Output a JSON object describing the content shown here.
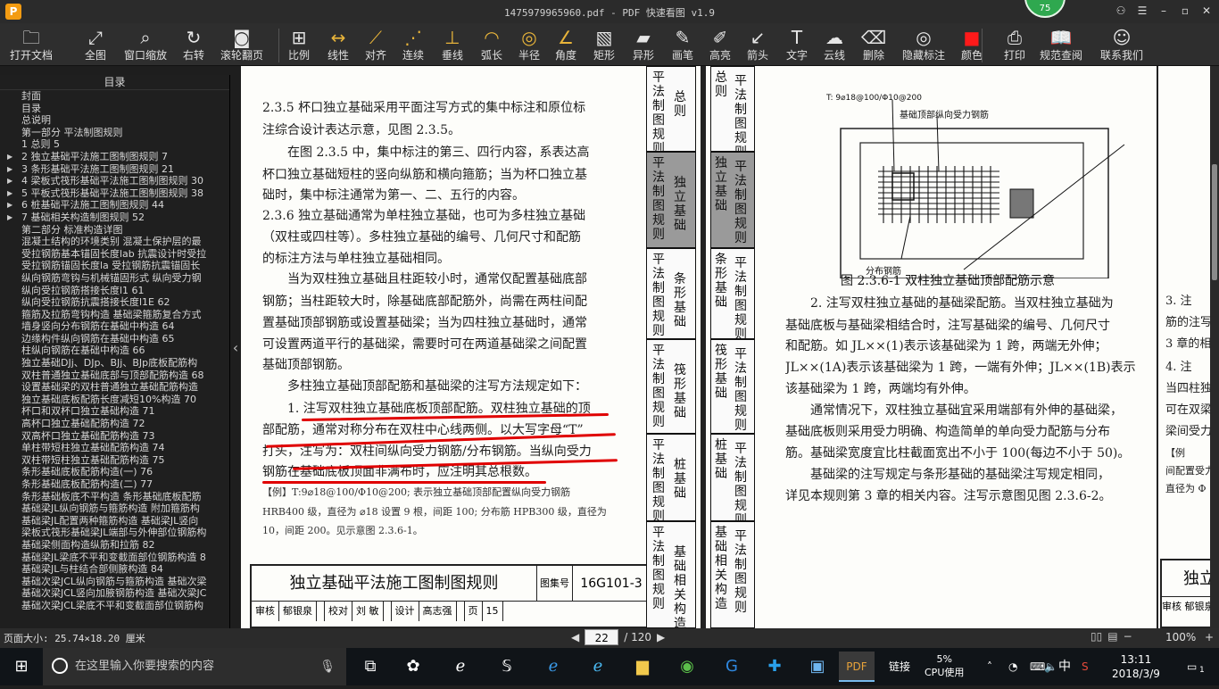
{
  "window": {
    "title": "1475979965960.pdf - PDF 快速看图 v1.9",
    "logo": "P",
    "badge": "75"
  },
  "toolbar": [
    {
      "label": "打开文档",
      "icon": "folder-icon",
      "glyph": "🗀"
    },
    {
      "label": "全图",
      "icon": "fit-icon",
      "glyph": "⤢"
    },
    {
      "label": "窗口缩放",
      "icon": "zoom-icon",
      "glyph": "⌕"
    },
    {
      "label": "右转",
      "icon": "rotate-icon",
      "glyph": "↻"
    },
    {
      "label": "滚轮翻页",
      "icon": "mouse-icon",
      "glyph": "◙"
    },
    {
      "label": "比例",
      "icon": "scale-icon",
      "glyph": "⊞"
    },
    {
      "label": "线性",
      "icon": "linear-icon",
      "glyph": "↔"
    },
    {
      "label": "对齐",
      "icon": "align-icon",
      "glyph": "⟋"
    },
    {
      "label": "连续",
      "icon": "continuous-icon",
      "glyph": "⋰"
    },
    {
      "label": "垂线",
      "icon": "perpendicular-icon",
      "glyph": "⊥"
    },
    {
      "label": "弧长",
      "icon": "arc-icon",
      "glyph": "◠"
    },
    {
      "label": "半径",
      "icon": "radius-icon",
      "glyph": "◎"
    },
    {
      "label": "角度",
      "icon": "angle-icon",
      "glyph": "∠"
    },
    {
      "label": "矩形",
      "icon": "rect-icon",
      "glyph": "▧"
    },
    {
      "label": "异形",
      "icon": "polygon-icon",
      "glyph": "▰"
    },
    {
      "label": "画笔",
      "icon": "pen-icon",
      "glyph": "✎"
    },
    {
      "label": "高亮",
      "icon": "highlight-icon",
      "glyph": "✐"
    },
    {
      "label": "箭头",
      "icon": "arrow-icon",
      "glyph": "↙"
    },
    {
      "label": "文字",
      "icon": "text-icon",
      "glyph": "T"
    },
    {
      "label": "云线",
      "icon": "cloud-icon",
      "glyph": "☁"
    },
    {
      "label": "删除",
      "icon": "eraser-icon",
      "glyph": "⌫"
    },
    {
      "label": "隐藏标注",
      "icon": "hide-icon",
      "glyph": "◎"
    },
    {
      "label": "颜色",
      "icon": "color-icon",
      "glyph": "■"
    },
    {
      "label": "打印",
      "icon": "print-icon",
      "glyph": "⎙"
    },
    {
      "label": "规范查阅",
      "icon": "book-icon",
      "glyph": "📖"
    },
    {
      "label": "联系我们",
      "icon": "contact-icon",
      "glyph": "☺"
    }
  ],
  "sidebar": {
    "title": "目录",
    "items": [
      {
        "label": "封面",
        "arrow": ""
      },
      {
        "label": "目录",
        "arrow": ""
      },
      {
        "label": "总说明",
        "arrow": ""
      },
      {
        "label": "第一部分 平法制图规则",
        "arrow": ""
      },
      {
        "label": "1 总则 5",
        "arrow": ""
      },
      {
        "label": "2 独立基础平法施工图制图规则 7",
        "arrow": "▶"
      },
      {
        "label": "3 条形基础平法施工图制图规则 21",
        "arrow": "▶"
      },
      {
        "label": "4 梁板式筏形基础平法施工图制图规则 30",
        "arrow": "▶"
      },
      {
        "label": "5 平板式筏形基础平法施工图制图规则 38",
        "arrow": "▶"
      },
      {
        "label": "6 桩基础平法施工图制图规则 44",
        "arrow": "▶"
      },
      {
        "label": "7 基础相关构造制图规则 52",
        "arrow": "▶"
      },
      {
        "label": "第二部分 标准构造详图",
        "arrow": ""
      },
      {
        "label": "混凝土结构的环境类别 混凝土保护层的最",
        "arrow": ""
      },
      {
        "label": "受拉钢筋基本锚固长度lab 抗震设计时受拉",
        "arrow": ""
      },
      {
        "label": "受拉钢筋锚固长度la 受拉钢筋抗震锚固长",
        "arrow": ""
      },
      {
        "label": "纵向钢筋弯钩与机械锚固形式 纵向受力钢",
        "arrow": ""
      },
      {
        "label": "纵向受拉钢筋搭接长度l1 61",
        "arrow": ""
      },
      {
        "label": "纵向受拉钢筋抗震搭接长度l1E 62",
        "arrow": ""
      },
      {
        "label": "箍筋及拉筋弯钩构造 基础梁箍筋复合方式",
        "arrow": ""
      },
      {
        "label": "墙身竖向分布钢筋在基础中构造 64",
        "arrow": ""
      },
      {
        "label": "边缘构件纵向钢筋在基础中构造 65",
        "arrow": ""
      },
      {
        "label": "柱纵向钢筋在基础中构造 66",
        "arrow": ""
      },
      {
        "label": "独立基础DJj、DJp、BJj、BJp底板配筋构",
        "arrow": ""
      },
      {
        "label": "双柱普通独立基础底部与顶部配筋构造 68",
        "arrow": ""
      },
      {
        "label": "设置基础梁的双柱普通独立基础配筋构造",
        "arrow": ""
      },
      {
        "label": "独立基础底板配筋长度减短10%构造 70",
        "arrow": ""
      },
      {
        "label": "杯口和双杯口独立基础构造 71",
        "arrow": ""
      },
      {
        "label": "高杯口独立基础配筋构造 72",
        "arrow": ""
      },
      {
        "label": "双高杯口独立基础配筋构造 73",
        "arrow": ""
      },
      {
        "label": "单柱带短柱独立基础配筋构造 74",
        "arrow": ""
      },
      {
        "label": "双柱带短柱独立基础配筋构造 75",
        "arrow": ""
      },
      {
        "label": "条形基础底板配筋构造(一) 76",
        "arrow": ""
      },
      {
        "label": "条形基础底板配筋构造(二) 77",
        "arrow": ""
      },
      {
        "label": "条形基础板底不平构造 条形基础底板配筋",
        "arrow": ""
      },
      {
        "label": "基础梁JL纵向钢筋与箍筋构造 附加箍筋构",
        "arrow": ""
      },
      {
        "label": "基础梁JL配置两种箍筋构造 基础梁JL竖向",
        "arrow": ""
      },
      {
        "label": "梁板式筏形基础梁JL端部与外伸部位钢筋构",
        "arrow": ""
      },
      {
        "label": "基础梁侧面构造纵筋和拉筋 82",
        "arrow": ""
      },
      {
        "label": "基础梁JL梁底不平和变截面部位钢筋构造 8",
        "arrow": ""
      },
      {
        "label": "基础梁JL与柱结合部侧腋构造 84",
        "arrow": ""
      },
      {
        "label": "基础次梁JCL纵向钢筋与箍筋构造 基础次梁",
        "arrow": ""
      },
      {
        "label": "基础次梁JCL竖向加腋钢筋构造 基础次梁JC",
        "arrow": ""
      },
      {
        "label": "基础次梁JCL梁底不平和变截面部位钢筋构",
        "arrow": ""
      }
    ]
  },
  "left_page": {
    "lines": [
      "2.3.5 杯口独立基础采用平面注写方式的集中标注和原位标",
      "注综合设计表达示意，见图 2.3.5。",
      "　　在图 2.3.5 中，集中标注的第三、四行内容，系表达高",
      "杯口独立基础短柱的竖向纵筋和横向箍筋；当为杯口独立基",
      "础时，集中标注通常为第一、二、五行的内容。",
      "2.3.6 独立基础通常为单柱独立基础，也可为多柱独立基础",
      "（双柱或四柱等）。多柱独立基础的编号、几何尺寸和配筋",
      "的标注方法与单柱独立基础相同。",
      "　　当为双柱独立基础且柱距较小时，通常仅配置基础底部",
      "钢筋；当柱距较大时，除基础底部配筋外，尚需在两柱间配",
      "置基础顶部钢筋或设置基础梁；当为四柱独立基础时，通常",
      "可设置两道平行的基础梁，需要时可在两道基础梁之间配置",
      "基础顶部钢筋。",
      "　　多柱独立基础顶部配筋和基础梁的注写方法规定如下：",
      "　　1. 注写双柱独立基础底板顶部配筋。双柱独立基础的顶",
      "部配筋，通常对称分布在双柱中心线两侧。以大写字母“T”",
      "打头，注写为：双柱间纵向受力钢筋/分布钢筋。当纵向受力",
      "钢筋在基础底板顶面非满布时，应注明其总根数。"
    ],
    "example": [
      "【例】T:9⌀18@100/Φ10@200; 表示独立基础顶部配置纵向受力钢筋",
      "HRB400 级，直径为 ⌀18 设置 9 根，间距 100; 分布筋 HPB300 级，直径为",
      "10，间距 200。见示意图 2.3.6-1。"
    ],
    "footer": {
      "title": "独立基础平法施工图制图规则",
      "atlas_label": "图集号",
      "atlas_no": "16G101-3",
      "row2": [
        "审核",
        "郁银泉",
        "",
        "校对",
        "刘 敏",
        "",
        "设计",
        "高志强",
        "",
        "页",
        "15"
      ]
    }
  },
  "side_tabs": [
    {
      "main": "平法制图规则",
      "sub": "总则",
      "active": false
    },
    {
      "main": "平法制图规则",
      "sub": "独立基础",
      "active": true
    },
    {
      "main": "平法制图规则",
      "sub": "条形基础",
      "active": false
    },
    {
      "main": "平法制图规则",
      "sub": "筏形基础",
      "active": false
    },
    {
      "main": "平法制图规则",
      "sub": "桩基础",
      "active": false
    },
    {
      "main": "平法制图规则",
      "sub": "基础相关构造",
      "active": false
    }
  ],
  "right_tabs": [
    {
      "sub": "总则",
      "main": "平法制图规则",
      "active": false
    },
    {
      "sub": "独立基础",
      "main": "平法制图规则",
      "active": true
    },
    {
      "sub": "条形基础",
      "main": "平法制图规则",
      "active": false
    },
    {
      "sub": "筏形基础",
      "main": "平法制图规则",
      "active": false
    },
    {
      "sub": "桩基础",
      "main": "平法制图规则",
      "active": false
    },
    {
      "sub": "基础相关构造",
      "main": "平法制图规则",
      "active": false
    }
  ],
  "figure": {
    "label_top": "T: 9⌀18@100/Φ10@200",
    "label_rebar": "基础顶部纵向受力钢筋",
    "label_dist": "分布钢筋",
    "caption": "图 2.3.6-1 双柱独立基础顶部配筋示意"
  },
  "right_page": {
    "lines": [
      "　　2. 注写双柱独立基础的基础梁配筋。当双柱独立基础为",
      "基础底板与基础梁相结合时，注写基础梁的编号、几何尺寸",
      "和配筋。如 JL××(1)表示该基础梁为 1 跨，两端无外伸；",
      "JL××(1A)表示该基础梁为 1 跨，一端有外伸；JL××(1B)表示",
      "该基础梁为 1 跨，两端均有外伸。",
      "　　通常情况下，双柱独立基础宜采用端部有外伸的基础梁，",
      "基础底板则采用受力明确、构造简单的单向受力配筋与分布",
      "筋。基础梁宽度宜比柱截面宽出不小于 100(每边不小于 50)。",
      "　　基础梁的注写规定与条形基础的基础梁注写规定相同，",
      "详见本规则第 3 章的相关内容。注写示意图见图 2.3.6-2。"
    ],
    "edge_lines": [
      "3. 注",
      "筋的注写",
      "3 章的相",
      "4. 注",
      "当四柱独",
      "可在双梁",
      "梁间受力",
      "【例",
      "间配置受力",
      "直径为 Φ"
    ],
    "edge_footer_title": "独立",
    "edge_footer_row": [
      "审核",
      "郁银泉"
    ]
  },
  "status": {
    "page_size": "页面大小: 25.74×18.20 厘米",
    "current_page": "22",
    "total_pages": "/ 120",
    "zoom": "100%"
  },
  "taskbar": {
    "search_placeholder": "在这里输入你要搜索的内容",
    "cpu_percent": "5%",
    "cpu_label": "CPU使用",
    "link_label": "链接",
    "ime": "中",
    "time": "13:11",
    "date": "2018/3/9",
    "notifications": "1"
  }
}
